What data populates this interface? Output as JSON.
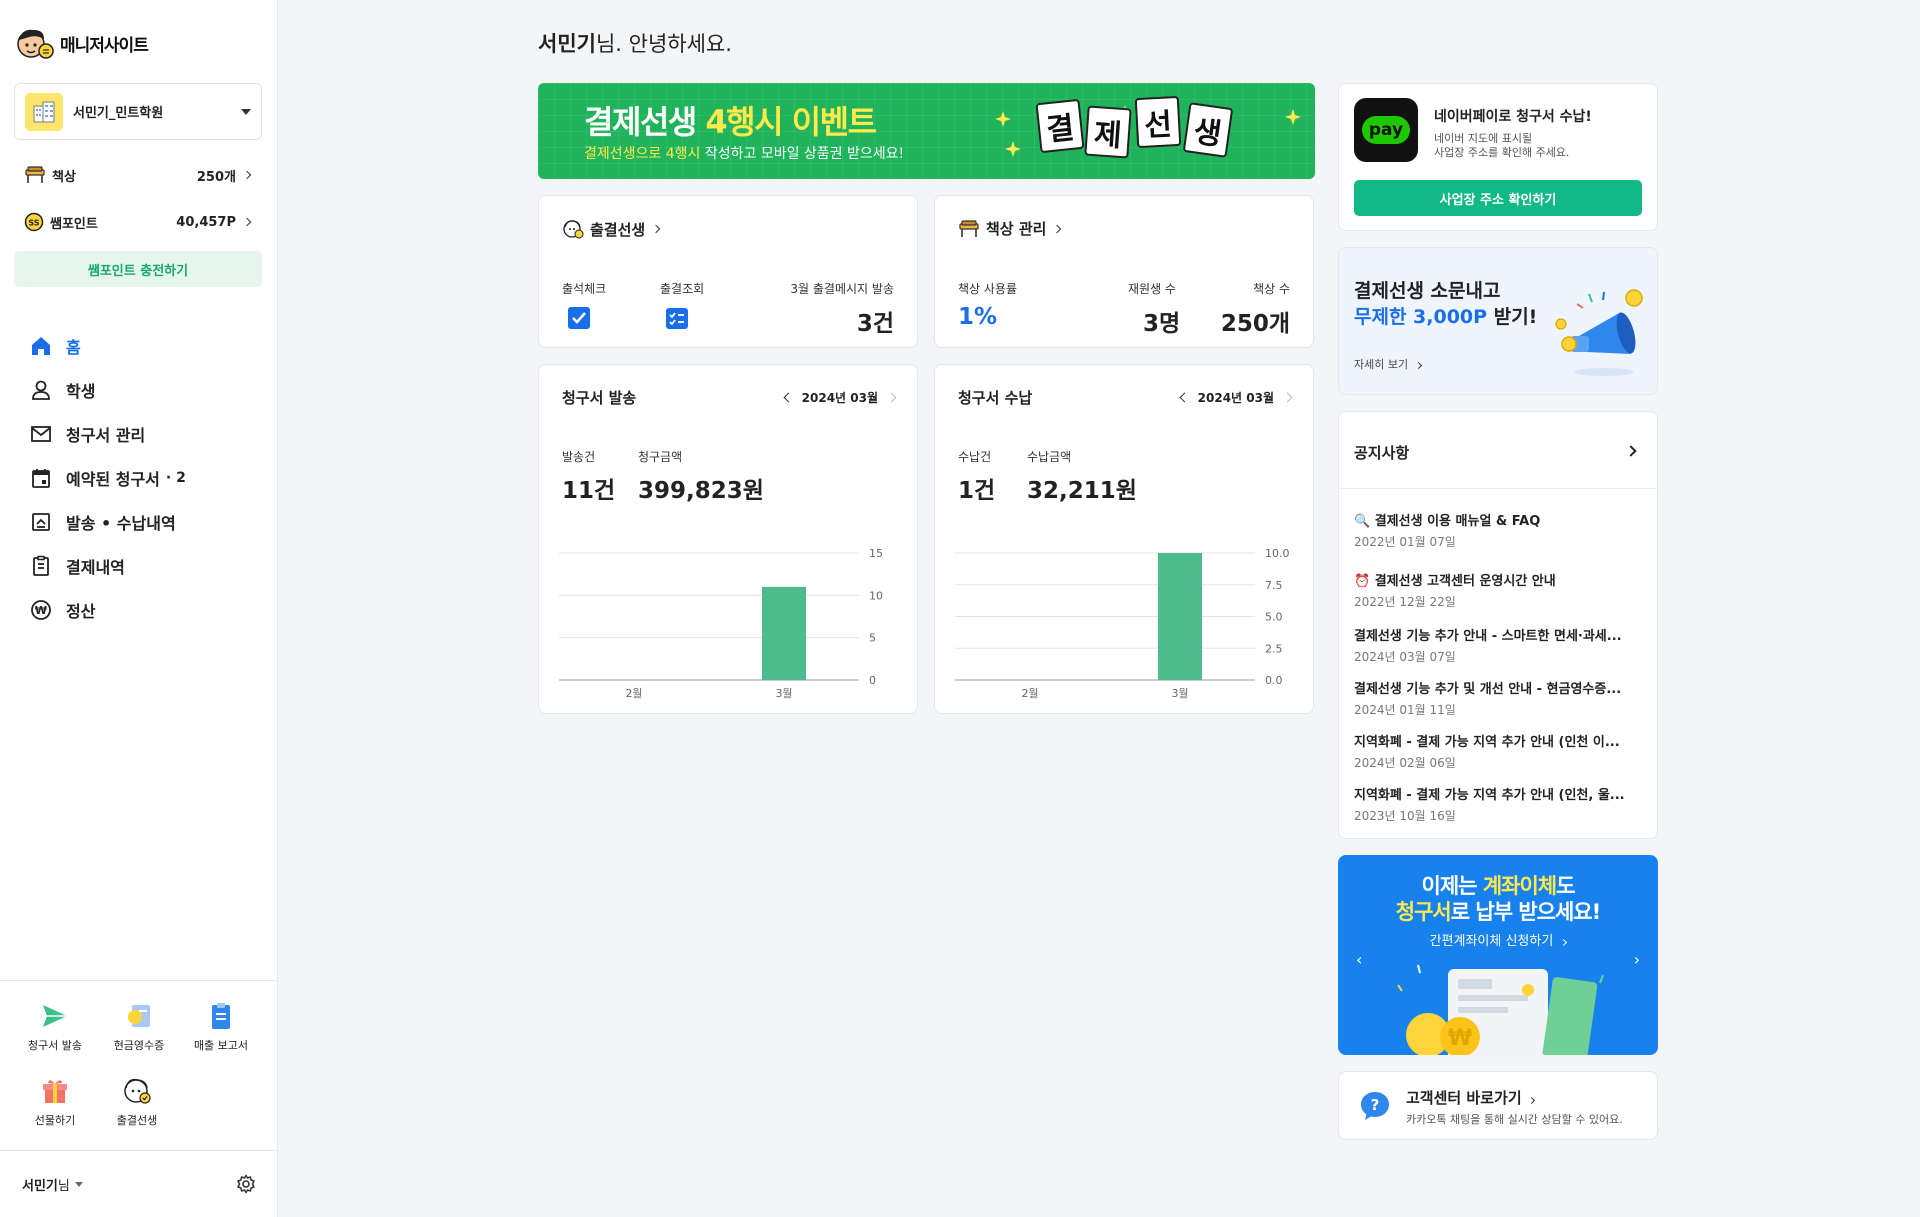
{
  "sidebar": {
    "logo_text": "매니저사이트",
    "academy_name": "서민기_민트학원",
    "stats": [
      {
        "label": "책상",
        "value": "250개"
      },
      {
        "label": "쌤포인트",
        "value": "40,457P"
      }
    ],
    "charge_label": "쌤포인트 충전하기",
    "nav": [
      {
        "label": "홈"
      },
      {
        "label": "학생"
      },
      {
        "label": "청구서 관리"
      },
      {
        "label": "예약된 청구서",
        "suffix": "· 2"
      },
      {
        "label": "발송 • 수납내역"
      },
      {
        "label": "결제내역"
      },
      {
        "label": "정산"
      }
    ],
    "quick": [
      {
        "label": "청구서 발송"
      },
      {
        "label": "현금영수증"
      },
      {
        "label": "매출 보고서"
      },
      {
        "label": "선물하기"
      },
      {
        "label": "출결선생"
      }
    ],
    "user_name": "서민기",
    "user_suffix": "님"
  },
  "main": {
    "greeting_name": "서민기",
    "greeting_rest": "님. 안녕하세요.",
    "event_banner": {
      "title_a": "결제선생 ",
      "title_b": "4행시 이벤트",
      "sub_a": "결제선생으로 4행시",
      "sub_b": " 작성하고 모바일 상품권 받으세요!",
      "tiles": [
        "결",
        "제",
        "선",
        "생"
      ]
    },
    "attendance": {
      "title": "출결선생",
      "check_label": "출석체크",
      "lookup_label": "출결조회",
      "msg_label": "3월 출결메시지 발송",
      "msg_value": "3건"
    },
    "desk": {
      "title": "책상 관리",
      "usage_label": "책상 사용률",
      "usage_value": "1%",
      "students_label": "재원생 수",
      "students_value": "3명",
      "desks_label": "책상 수",
      "desks_value": "250개"
    },
    "invoice_sent": {
      "title": "청구서 발송",
      "month": "2024년 03월",
      "count_label": "발송건",
      "count_value": "11건",
      "amount_label": "청구금액",
      "amount_value": "399,823원"
    },
    "invoice_paid": {
      "title": "청구서 수납",
      "month": "2024년 03월",
      "count_label": "수납건",
      "count_value": "1건",
      "amount_label": "수납금액",
      "amount_value": "32,211원"
    }
  },
  "right": {
    "naverpay": {
      "pill": "pay",
      "title": "네이버페이로 청구서 수납!",
      "desc1": "네이버 지도에 표시될",
      "desc2": "사업장 주소를 확인해 주세요.",
      "button": "사업장 주소 확인하기"
    },
    "promo": {
      "line1": "결제선생 소문내고",
      "line2_a": "무제한 3,000P",
      "line2_b": " 받기!",
      "link": "자세히 보기"
    },
    "notices": {
      "title": "공지사항",
      "items": [
        {
          "title": "🔍 결제선생 이용 매뉴얼 & FAQ",
          "date": "2022년 01월 07일"
        },
        {
          "title": "⏰ 결제선생 고객센터 운영시간 안내",
          "date": "2022년 12월 22일"
        },
        {
          "title": "결제선생 기능 추가 안내 - 스마트한 면세·과세...",
          "date": "2024년 03월 07일"
        },
        {
          "title": "결제선생 기능 추가 및 개선 안내 - 현금영수증...",
          "date": "2024년 01월 11일"
        },
        {
          "title": "지역화폐 - 결제 가능 지역 추가 안내 (인천 이...",
          "date": "2024년 02월 06일"
        },
        {
          "title": "지역화폐 - 결제 가능 지역 추가 안내 (인천, 울...",
          "date": "2023년 10월 16일"
        }
      ]
    },
    "transfer_banner": {
      "line1_a": "이제는 ",
      "line1_b": "계좌이체",
      "line1_c": "도",
      "line2_a": "청구서",
      "line2_b": "로 납부 받으세요!",
      "link": "간편계좌이체 신청하기",
      "coin": "₩"
    },
    "support": {
      "title": "고객센터 바로가기",
      "desc": "카카오톡 채팅을 통해 실시간 상담할 수 있어요."
    }
  },
  "chart_data": [
    {
      "type": "bar",
      "categories": [
        "2월",
        "3월"
      ],
      "series": [
        {
          "values": [
            0,
            11
          ]
        }
      ],
      "ylim": [
        0,
        15
      ],
      "yticks": [
        "0",
        "5",
        "10",
        "15"
      ],
      "color": "#4dbb8c",
      "grid": true
    },
    {
      "type": "bar",
      "categories": [
        "2월",
        "3월"
      ],
      "series": [
        {
          "values": [
            0,
            1
          ]
        }
      ],
      "ylim": [
        0,
        1
      ],
      "yticks": [
        "0.0",
        "2.5",
        "5.0",
        "7.5",
        "10.0"
      ],
      "color": "#4dbb8c",
      "grid": true
    }
  ]
}
